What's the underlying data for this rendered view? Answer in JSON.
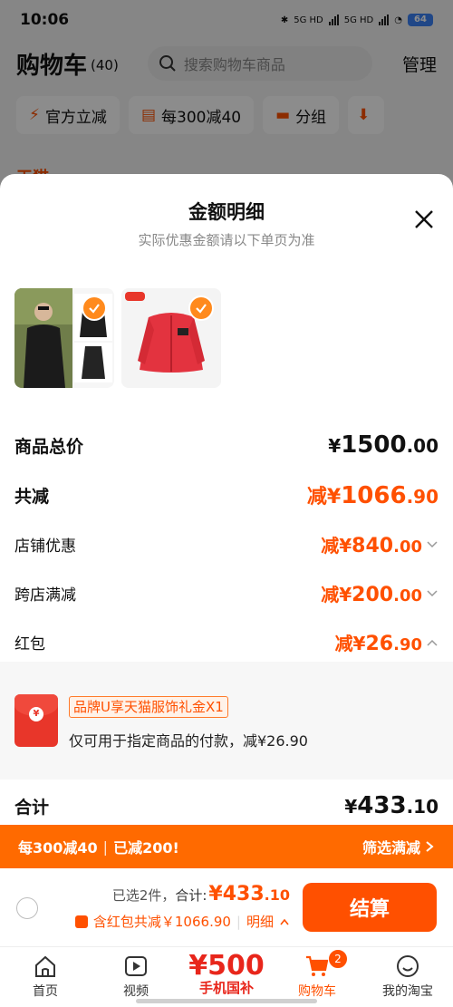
{
  "status_bar": {
    "time": "10:06",
    "battery": "64",
    "network_1": "5G HD",
    "network_2": "5G HD"
  },
  "cart_header": {
    "title": "购物车",
    "count": "(40)",
    "search_placeholder": "搜索购物车商品",
    "manage": "管理"
  },
  "filter_chips": [
    {
      "label": "官方立减",
      "icon": "lightning-icon"
    },
    {
      "label": "每300减40",
      "icon": "shop-icon"
    },
    {
      "label": "分组",
      "icon": "folder-icon"
    }
  ],
  "bg_shop_partial": "天猫",
  "sheet": {
    "title": "金额明细",
    "subtitle": "实际优惠金额请以下单页为准",
    "products": [
      {
        "name": "black-jacket-product"
      },
      {
        "name": "red-dickies-jacket-product"
      }
    ],
    "rows": {
      "total": {
        "label": "商品总价",
        "currency": "¥",
        "int": "1500",
        "dec": ".00"
      },
      "reduction": {
        "label": "共减",
        "prefix": "减¥",
        "int": "1066",
        "dec": ".90"
      },
      "shop_discount": {
        "label": "店铺优惠",
        "prefix": "减¥",
        "int": "840",
        "dec": ".00"
      },
      "cross_store": {
        "label": "跨店满减",
        "prefix": "减¥",
        "int": "200",
        "dec": ".00"
      },
      "red_packet": {
        "label": "红包",
        "prefix": "减¥",
        "int": "26",
        "dec": ".90"
      }
    },
    "coupon": {
      "tag": "品牌U享天猫服饰礼金X1",
      "desc": "仅可用于指定商品的付款，减¥26.90",
      "seal": "¥"
    },
    "sum": {
      "label": "合计",
      "currency": "¥",
      "int": "433",
      "dec": ".10"
    }
  },
  "promo_bar": {
    "left_1": "每300减40",
    "left_2": "已减200!",
    "right": "筛选满减"
  },
  "checkout": {
    "selected": "已选2件，",
    "total_label": "合计: ",
    "price_int": "¥433",
    "price_dec": ".10",
    "discount": "含红包共减￥1066.90",
    "detail": "明细",
    "pay": "结算"
  },
  "tabs": [
    {
      "label": "首页",
      "icon": "home-icon"
    },
    {
      "label": "视频",
      "icon": "video-icon"
    },
    {
      "promo_number": "¥500",
      "promo_text": "手机国补"
    },
    {
      "label": "购物车",
      "icon": "cart-icon",
      "badge": "2",
      "active": true
    },
    {
      "label": "我的淘宝",
      "icon": "profile-icon"
    }
  ],
  "colors": {
    "accent": "#ff5000",
    "promo_bar": "#ff6a00",
    "check": "#ff8a1d"
  }
}
